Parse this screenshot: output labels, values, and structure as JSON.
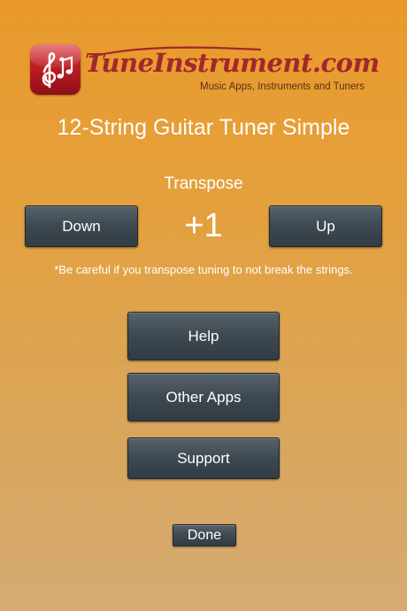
{
  "header": {
    "brand_name": "TuneInstrument.com",
    "tagline": "Music Apps, Instruments and Tuners",
    "icon": "music-notes-icon",
    "colors": {
      "icon_red": "#b51b22",
      "brand_text": "#a3272b"
    }
  },
  "page_title": "12-String Guitar Tuner Simple",
  "transpose": {
    "label": "Transpose",
    "down_label": "Down",
    "value": "+1",
    "up_label": "Up",
    "warning": "*Be careful if you transpose tuning to not break the strings."
  },
  "menu": {
    "help_label": "Help",
    "other_apps_label": "Other Apps",
    "support_label": "Support"
  },
  "done_label": "Done",
  "colors": {
    "background_top": "#e99a2a",
    "background_bottom": "#d5ab73",
    "button": "#3d4850",
    "text": "#ffffff"
  }
}
